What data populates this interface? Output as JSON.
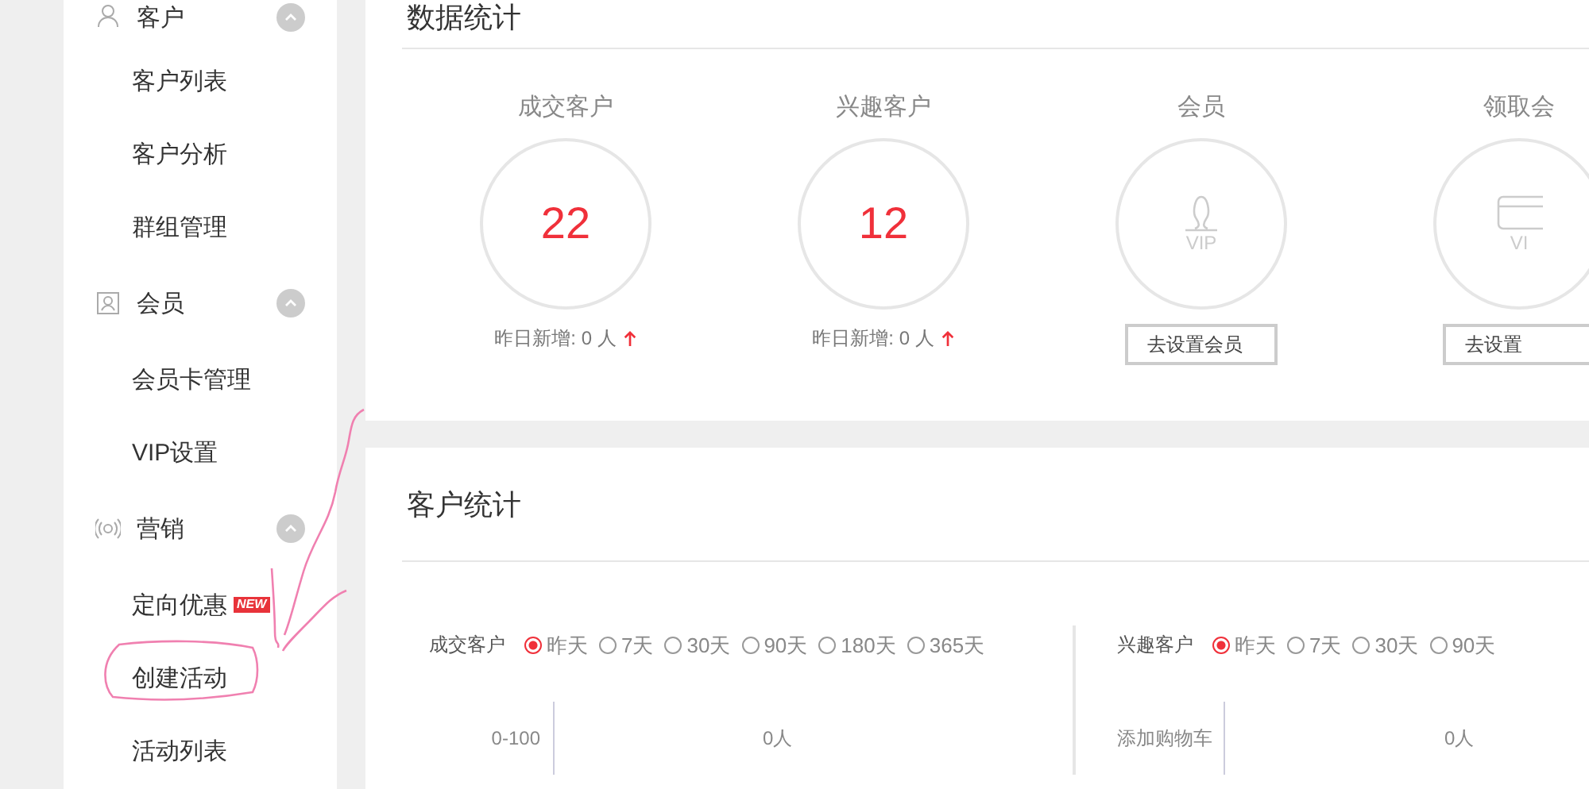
{
  "sidebar": {
    "groups": [
      {
        "title": "客户",
        "expanded": true,
        "items": [
          {
            "label": "客户列表"
          },
          {
            "label": "客户分析"
          },
          {
            "label": "群组管理"
          }
        ]
      },
      {
        "title": "会员",
        "expanded": true,
        "items": [
          {
            "label": "会员卡管理"
          },
          {
            "label": "VIP设置"
          }
        ]
      },
      {
        "title": "营销",
        "expanded": true,
        "items": [
          {
            "label": "定向优惠",
            "badge": "NEW"
          },
          {
            "label": "创建活动"
          },
          {
            "label": "活动列表"
          }
        ]
      }
    ]
  },
  "overview": {
    "title": "数据统计",
    "stats": [
      {
        "kind": "count",
        "label": "成交客户",
        "value": "22",
        "note": "昨日新增: 0 人"
      },
      {
        "kind": "count",
        "label": "兴趣客户",
        "value": "12",
        "note": "昨日新增: 0 人"
      },
      {
        "kind": "setup",
        "label": "会员",
        "icon_text": "VIP",
        "button": "去设置会员"
      },
      {
        "kind": "setup",
        "label": "领取会",
        "icon_text": "VI",
        "button": "去设置"
      }
    ]
  },
  "customer_stats": {
    "title": "客户统计",
    "panels": [
      {
        "label": "成交客户",
        "options": [
          {
            "label": "昨天",
            "selected": true
          },
          {
            "label": "7天",
            "selected": false
          },
          {
            "label": "30天",
            "selected": false
          },
          {
            "label": "90天",
            "selected": false
          },
          {
            "label": "180天",
            "selected": false
          },
          {
            "label": "365天",
            "selected": false
          }
        ],
        "rows": [
          {
            "label": "0-100",
            "value": "0人"
          }
        ]
      },
      {
        "label": "兴趣客户",
        "options": [
          {
            "label": "昨天",
            "selected": true
          },
          {
            "label": "7天",
            "selected": false
          },
          {
            "label": "30天",
            "selected": false
          },
          {
            "label": "90天",
            "selected": false
          }
        ],
        "rows": [
          {
            "label": "添加购物车",
            "value": "0人"
          }
        ]
      }
    ]
  }
}
